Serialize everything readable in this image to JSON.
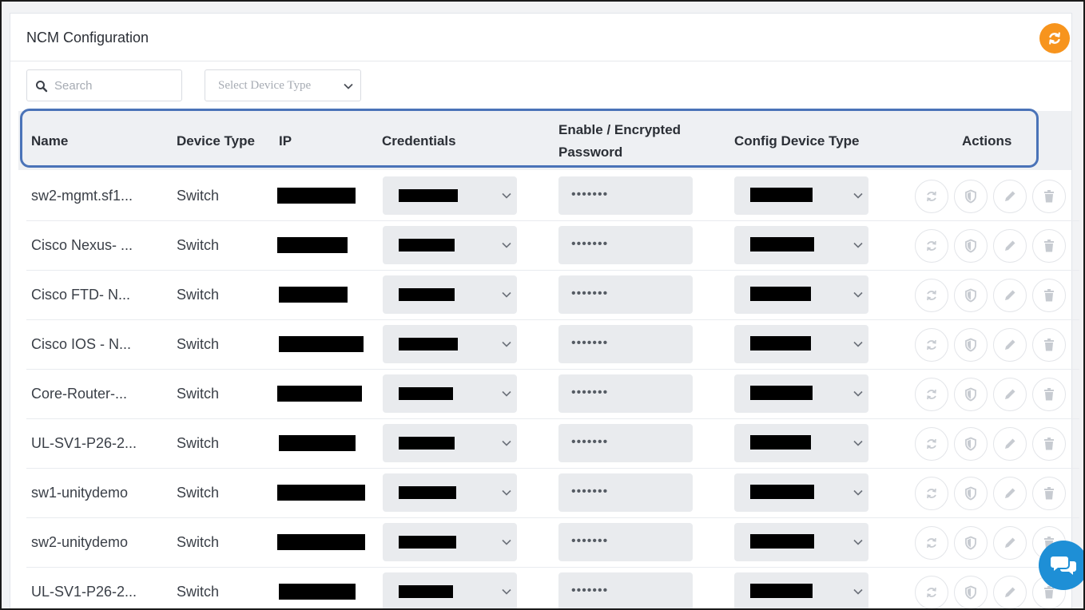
{
  "panel": {
    "title": "NCM Configuration"
  },
  "toolbar": {
    "search_placeholder": "Search",
    "device_type_placeholder": "Select Device Type"
  },
  "table": {
    "columns": {
      "name": "Name",
      "device_type": "Device Type",
      "ip": "IP",
      "credentials": "Credentials",
      "enable_line1": "Enable / Encrypted",
      "enable_line2": "Password",
      "config_device_type": "Config Device Type",
      "actions": "Actions"
    },
    "rows": [
      {
        "name": "sw2-mgmt.sf1...",
        "device_type": "Switch",
        "password": "•••••••"
      },
      {
        "name": "Cisco Nexus- ...",
        "device_type": "Switch",
        "password": "•••••••"
      },
      {
        "name": "Cisco FTD- N...",
        "device_type": "Switch",
        "password": "•••••••"
      },
      {
        "name": "Cisco IOS - N...",
        "device_type": "Switch",
        "password": "•••••••"
      },
      {
        "name": "Core-Router-...",
        "device_type": "Switch",
        "password": "•••••••"
      },
      {
        "name": "UL-SV1-P26-2...",
        "device_type": "Switch",
        "password": "•••••••"
      },
      {
        "name": "sw1-unitydemo",
        "device_type": "Switch",
        "password": "•••••••"
      },
      {
        "name": "sw2-unitydemo",
        "device_type": "Switch",
        "password": "•••••••"
      },
      {
        "name": "UL-SV1-P26-2...",
        "device_type": "Switch",
        "password": "•••••••"
      }
    ]
  },
  "icons": {
    "panel_refresh": "refresh-icon",
    "search": "search-icon",
    "row_actions": [
      "sync-icon",
      "shield-icon",
      "pencil-icon",
      "trash-icon"
    ],
    "chat": "chat-icon"
  },
  "colors": {
    "accent_orange": "#f7941d",
    "highlight_border": "#4a73b8",
    "chat_blue": "#1e8fd6"
  }
}
